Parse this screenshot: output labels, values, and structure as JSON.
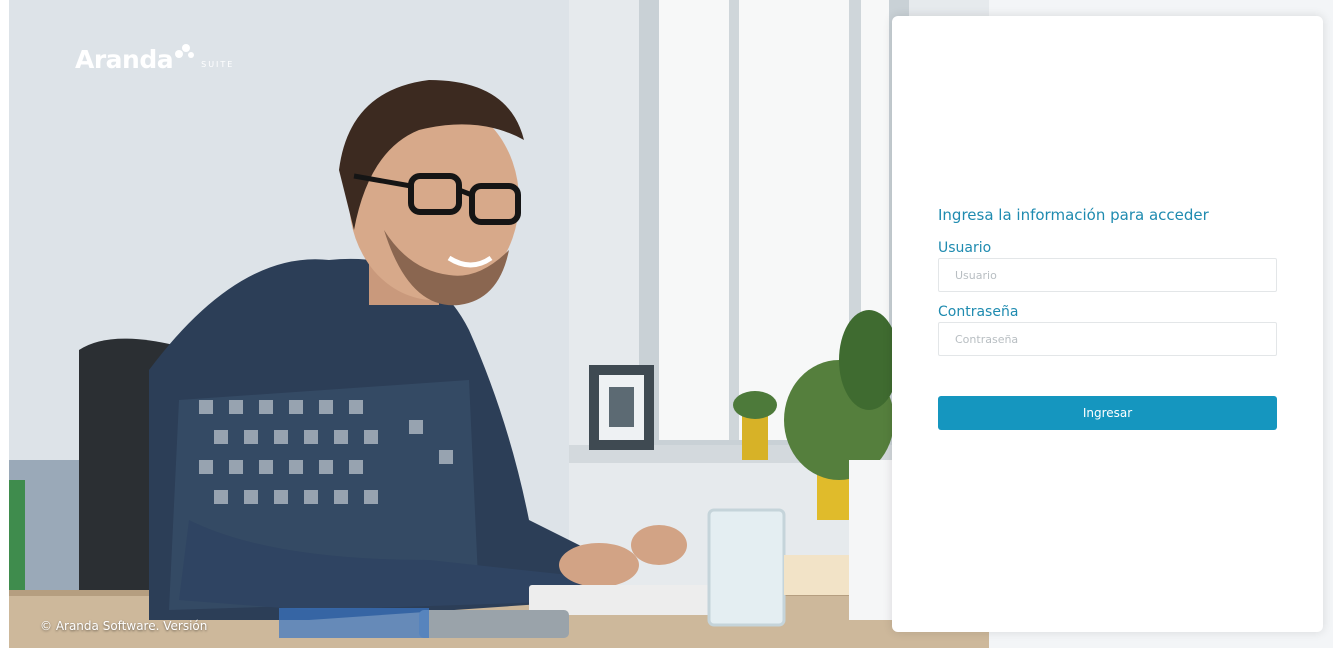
{
  "brand": {
    "name": "Aranda",
    "suite_label": "SUITE"
  },
  "footer": {
    "copyright": "© Aranda Software. Versión"
  },
  "login": {
    "heading": "Ingresa la información para acceder",
    "username_label": "Usuario",
    "username_placeholder": "Usuario",
    "username_value": "",
    "password_label": "Contraseña",
    "password_placeholder": "Contraseña",
    "password_value": "",
    "submit_label": "Ingresar"
  },
  "colors": {
    "accent": "#1f8bb0",
    "button": "#1596bf"
  },
  "icons": {
    "logo_mark": "brand-sprout-icon"
  }
}
